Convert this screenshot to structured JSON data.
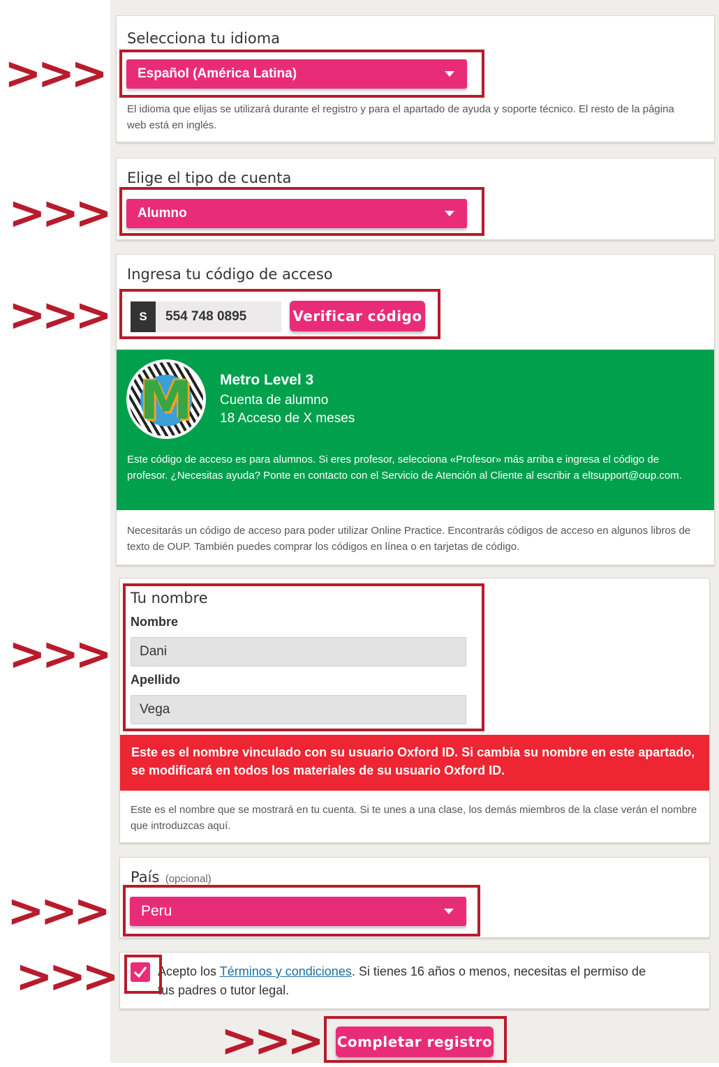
{
  "language": {
    "heading": "Selecciona tu idioma",
    "selected": "Español (América Latina)",
    "helper": "El idioma que elijas se utilizará durante el registro y para el apartado de ayuda y soporte técnico. El resto de la página web está en inglés."
  },
  "account": {
    "heading": "Elige el tipo de cuenta",
    "selected": "Alumno"
  },
  "access_code": {
    "heading": "Ingresa tu código de acceso",
    "prefix": "S",
    "code": "554  748  0895",
    "verify_label": "Verificar código",
    "product": {
      "logo_letter": "M",
      "title": "Metro Level 3",
      "type": "Cuenta de alumno",
      "duration": "18 Acceso de X meses",
      "notice": "Este código de acceso es para alumnos. Si eres profesor, selecciona «Profesor» más arriba e ingresa el código de profesor. ¿Necesitas ayuda? Ponte en contacto con el Servicio de Atención al Cliente al escribir a eltsupport@oup.com."
    },
    "helper": "Necesitarás un código de acceso para poder utilizar Online Practice. Encontrarás códigos de acceso en algunos libros de texto de OUP. También puedes comprar los códigos en línea o en tarjetas de código."
  },
  "name": {
    "heading": "Tu nombre",
    "first_label": "Nombre",
    "first_value": "Dani",
    "last_label": "Apellido",
    "last_value": "Vega",
    "warning": "Este es el nombre vinculado con su usuario Oxford ID. Si cambia su nombre en este apartado, se modificará en todos los materiales de su usuario Oxford ID.",
    "helper": "Este es el nombre que se mostrará en tu cuenta. Si te unes a una clase, los demás miembros de la clase verán el nombre que introduzcas aquí."
  },
  "country": {
    "heading": "País",
    "optional": "(opcional)",
    "selected": "Peru"
  },
  "terms": {
    "text_before": "Acepto los",
    "link": "Términos y condiciones",
    "text_after": ". Si tienes 16 años o menos, necesitas el permiso de tus padres o tutor legal."
  },
  "submit_label": "Completar registro",
  "arrow_marker": ">>>",
  "colors": {
    "accent_pink": "#e92c78",
    "highlight_red": "#b71c2c",
    "success_green": "#00a04c",
    "warning_red": "#ee2532"
  }
}
